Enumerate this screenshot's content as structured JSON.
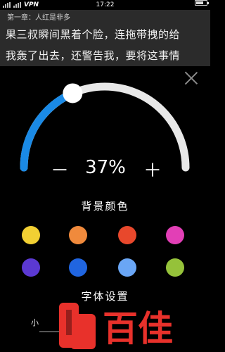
{
  "status_bar": {
    "carrier_icons": "signal-icon",
    "vpn": "VPN",
    "time": "17:22"
  },
  "reader": {
    "chapter": "第一章：人红是非多",
    "lines": [
      "果三叔瞬间黑着个脸，连拖带拽的给",
      "我轰了出去，还警告我，要将这事情"
    ]
  },
  "brightness": {
    "minus_label": "－",
    "value_text": "37%",
    "plus_label": "＋",
    "level_fraction": 0.37,
    "track_color": "#e8e8e8",
    "fill_color": "#1a8ae6"
  },
  "background_color": {
    "title": "背景颜色",
    "swatches": [
      "#f2d033",
      "#f08a3c",
      "#e8482c",
      "#e23fb6",
      "#5b39d2",
      "#2065e0",
      "#6aa6f5",
      "#95c23a"
    ]
  },
  "font_settings": {
    "title": "字体设置",
    "size_small": "小"
  },
  "watermark": {
    "text": "百佳"
  }
}
